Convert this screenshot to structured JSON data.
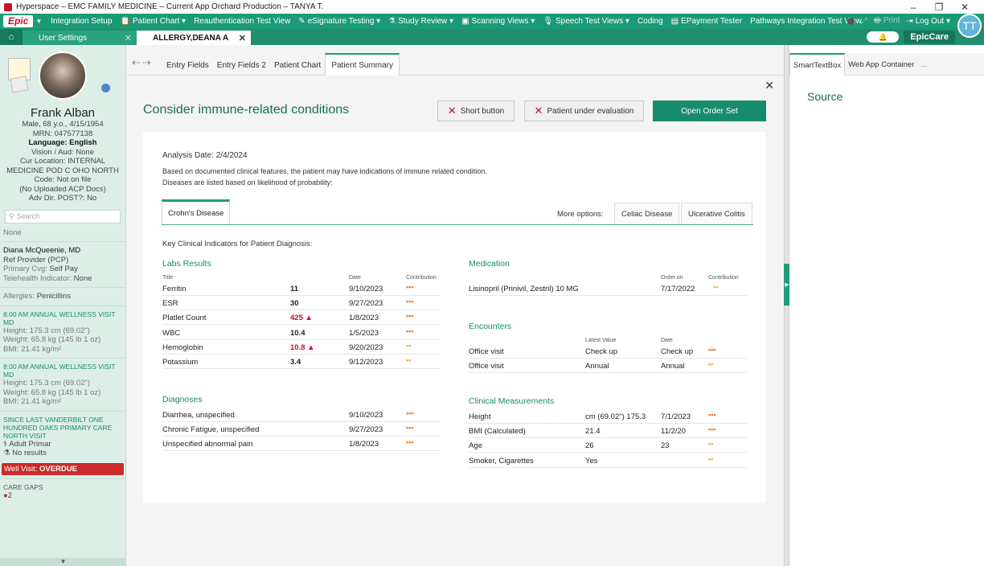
{
  "window": {
    "title": "Hyperspace – EMC FAMILY MEDICINE – Current App Orchard Production – TANYA T."
  },
  "menubar": {
    "logo": "Epic",
    "items": [
      "Integration Setup",
      "Patient Chart ▾",
      "Reauthentication Test View",
      "eSignature Testing ▾",
      "Study Review ▾",
      "Scanning Views ▾",
      "Speech Test Views ▾",
      "Coding",
      "EPayment Tester",
      "Pathways Integration Test View"
    ],
    "print": "Print",
    "logout": "Log Out"
  },
  "workspace": {
    "tabs": [
      {
        "label": "User Settings"
      },
      {
        "label": "ALLERGY,DEANA A"
      }
    ],
    "epiccare": "EpicCare",
    "user_initials": "TT"
  },
  "patient": {
    "name": "Frank Alban",
    "line1": "Male, 68 y.o., 4/15/1954",
    "mrn": "MRN: 047577138",
    "language_label": "Language:",
    "language": "English",
    "vision": "Vision / Aud: None",
    "location": "Cur Location: INTERNAL MEDICINE POD C OHO NORTH",
    "code": "Code: Not on file",
    "acp": "(No Uploaded ACP Docs)",
    "adv": "Adv Dir. POST?: No",
    "search_placeholder": "Search",
    "none": "None",
    "provider": "Diana McQueenie, MD",
    "provider_role": "Ref Provider (PCP)",
    "coverage_label": "Primary Cvg:",
    "coverage": "Self Pay",
    "telehealth_label": "Telehealth Indicator:",
    "telehealth": "None",
    "allergies_label": "Allergies:",
    "allergies": "Penicillins",
    "visit1": "8:00 AM ANNUAL WELLNESS VISIT MD",
    "height1": "Height:  175.3 cm (69.02\")",
    "weight1": "Weight:  65.8 kg (145 lb 1 oz)",
    "bmi1": "BMI:  21.41 kg/m²",
    "visit2": "8:00 AM ANNUAL WELLNESS VISIT MD",
    "height2": "Height:  175.3 cm (69.02\")",
    "weight2": "Weight:  65.8 kg (145 lb 1 oz)",
    "bmi2": "BMI:  21.41 kg/m²",
    "since": "SINCE LAST VANDERBILT ONE HUNDRED OAKS PRIMARY CARE NORTH VISIT",
    "adult_primar": "Adult Primar",
    "no_results": "No results",
    "overdue_label": "Well Visit:",
    "overdue": "OVERDUE",
    "care_gaps": "CARE GAPS",
    "care_gaps_count": "2"
  },
  "activity_tabs": [
    "Entry Fields",
    "Entry Fields 2",
    "Patient Chart",
    "Patient Summary"
  ],
  "main": {
    "heading": "Consider immune-related conditions",
    "short_button": "Short button",
    "eval_button": "Patient under evaluation",
    "order_button": "Open Order Set",
    "analysis_date": "Analysis Date: 2/4/2024",
    "desc1": "Based on documented clinical features, the patient may have indications of immune related condition.",
    "desc2": "Diseases are listed based on likelihood of probability:",
    "disease_tab": "Crohn's Disease",
    "more_options": "More options:",
    "option1": "Celiac Disease",
    "option2": "Ulcerative Colitis",
    "indicators_title": "Key Clinical Indicators for Patient Diagnosis:"
  },
  "labs": {
    "title": "Labs Results",
    "col_title": "Title",
    "col_date": "Date",
    "col_contrib": "Contribution",
    "rows": [
      {
        "name": "Ferritin",
        "value": "11",
        "date": "9/10/2023",
        "contrib": "•••",
        "high": false
      },
      {
        "name": "ESR",
        "value": "30",
        "date": "9/27/2023",
        "contrib": "•••",
        "high": false
      },
      {
        "name": "Platlet Count",
        "value": "425 ▲",
        "date": "1/8/2023",
        "contrib": "•••",
        "high": true
      },
      {
        "name": "WBC",
        "value": "10.4",
        "date": "1/5/2023",
        "contrib": "•••",
        "high": false
      },
      {
        "name": "Hemoglobin",
        "value": "10.8 ▲",
        "date": "9/20/2023",
        "contrib": "••",
        "high": true
      },
      {
        "name": "Potassium",
        "value": "3.4",
        "date": "9/12/2023",
        "contrib": "••",
        "high": false
      }
    ]
  },
  "diagnoses": {
    "title": "Diagnoses",
    "rows": [
      {
        "name": "Diarrhea, unspecified",
        "date": "9/10/2023",
        "contrib": "•••"
      },
      {
        "name": "Chronic Fatigue, unspecified",
        "date": "9/27/2023",
        "contrib": "•••"
      },
      {
        "name": "Unspecified abnormal pain",
        "date": "1/8/2023",
        "contrib": "•••"
      }
    ]
  },
  "medication": {
    "title": "Medication",
    "col_order": "Order on",
    "col_contrib": "Contribution",
    "rows": [
      {
        "name": "Lisinopril (Prinivil, Zestril) 10 MG",
        "date": "7/17/2022",
        "contrib": "••"
      }
    ]
  },
  "encounters": {
    "title": "Encounters",
    "col_latest": "Latest Value",
    "col_date": "Date",
    "rows": [
      {
        "name": "Office visit",
        "value": "Check up",
        "date": "Check up",
        "contrib": "•••"
      },
      {
        "name": "Office visit",
        "value": "Annual",
        "date": "Annual",
        "contrib": "••"
      }
    ]
  },
  "measurements": {
    "title": "Clinical Measurements",
    "rows": [
      {
        "name": "Height",
        "value": "cm (69.02\") 175.3",
        "date": "7/1/2023",
        "contrib": "•••"
      },
      {
        "name": "BMI (Calculated)",
        "value": "21.4",
        "date": "11/2/20",
        "contrib": "•••"
      },
      {
        "name": "Age",
        "value": "26",
        "date": "23",
        "contrib": "••"
      },
      {
        "name": "Smoker, Cigarettes",
        "value": "Yes",
        "date": "",
        "contrib": "••"
      }
    ]
  },
  "right_pane": {
    "tabs": [
      "SmartTextBox",
      "Web App Container"
    ],
    "more": "...",
    "source": "Source"
  },
  "colors": {
    "accent": "#1f9c78",
    "primary_button": "#178c6c",
    "high": "#c8102e",
    "contrib3": "#f07a1a",
    "contrib2": "#f0b21a"
  }
}
